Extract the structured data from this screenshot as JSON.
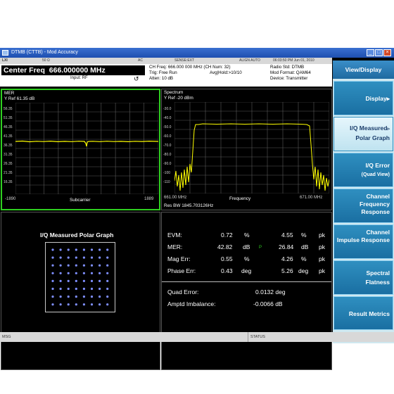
{
  "window": {
    "title": "DTMB (CTTB) - Mod Accuracy",
    "controls": [
      "_",
      "□",
      "×"
    ]
  },
  "status_strip": {
    "lxi": "LXI",
    "impedance": "50 Ω",
    "coupling": "AC",
    "sense": "SENSE:EXT",
    "align": "ALIGN AUTO",
    "datetime": "06:03:50 PM Jun 01, 2010"
  },
  "header": {
    "center_freq_label": "Center Freq",
    "center_freq_value": "666.000000 MHz",
    "input": "Input: RF",
    "ch_freq": "CH Freq: 666.000 000 MHz (CH Num: 32)",
    "trig": "Trig: Free Run",
    "avg_hold": "Avg|Hold:>10/10",
    "atten": "Atten: 10 dB",
    "radio_std": "Radio Std: DTMB",
    "mod_format": "Mod Format: QAM64",
    "device": "Device: Transmitter"
  },
  "mer_pane": {
    "title": "MER",
    "yref": "Y Ref  61.35 dB",
    "yticks": [
      "56.35",
      "51.35",
      "46.35",
      "41.35",
      "36.35",
      "31.35",
      "26.35",
      "21.35",
      "16.35"
    ],
    "x_left": "-1890",
    "x_label": "Subcarrier",
    "x_right": "1889"
  },
  "spectrum_pane": {
    "title": "Spectrum",
    "yref": "Y Ref  -20 dBm",
    "yticks": [
      "-30.0",
      "-40.0",
      "-50.0",
      "-60.0",
      "-70.0",
      "-80.0",
      "-90.0",
      "-100",
      "-110"
    ],
    "x_left": "661.00 MHz",
    "x_label": "Frequency",
    "x_right": "671.00 MHz",
    "res_bw": "Res BW 1845.703126Hz"
  },
  "polar_pane": {
    "title": "I/Q Measured Polar Graph"
  },
  "metrics": {
    "rows": [
      {
        "label": "EVM:",
        "v1": "0.72",
        "u1": "%",
        "flag": "",
        "v2": "4.55",
        "u2": "%",
        "suffix": "pk"
      },
      {
        "label": "MER:",
        "v1": "42.82",
        "u1": "dB",
        "flag": "P",
        "v2": "26.84",
        "u2": "dB",
        "suffix": "pk"
      },
      {
        "label": "Mag Err:",
        "v1": "0.55",
        "u1": "%",
        "flag": "",
        "v2": "4.26",
        "u2": "%",
        "suffix": "pk"
      },
      {
        "label": "Phase Err:",
        "v1": "0.43",
        "u1": "deg",
        "flag": "",
        "v2": "5.26",
        "u2": "deg",
        "suffix": "pk"
      }
    ],
    "quad_error_label": "Quad Error:",
    "quad_error_value": "0.0132 deg",
    "amptd_label": "Amptd Imbalance:",
    "amptd_value": "-0.0066 dB"
  },
  "softkeys": {
    "menu_title": "View/Display",
    "items": [
      {
        "line1": "Display",
        "line2": "",
        "arrow": "▸"
      },
      {
        "line1": "I/Q Measured",
        "line2": "Polar Graph",
        "arrow": "▹"
      },
      {
        "line1": "I/Q Error",
        "line2": "(Quad View)",
        "arrow": ""
      },
      {
        "line1": "Channel",
        "line2": "Frequency Response",
        "arrow": ""
      },
      {
        "line1": "Channel",
        "line2": "Impulse Response",
        "arrow": ""
      },
      {
        "line1": "Spectral",
        "line2": "Flatness",
        "arrow": ""
      },
      {
        "line1": "Result Metrics",
        "line2": "",
        "arrow": ""
      }
    ]
  },
  "bottom_bar": {
    "msg": "MSG",
    "status": "STATUS"
  },
  "colors": {
    "trace": "#ffff00",
    "active_border": "#2fd020",
    "softkey": "#1a6fa2",
    "constellation": "#7f8fff"
  }
}
